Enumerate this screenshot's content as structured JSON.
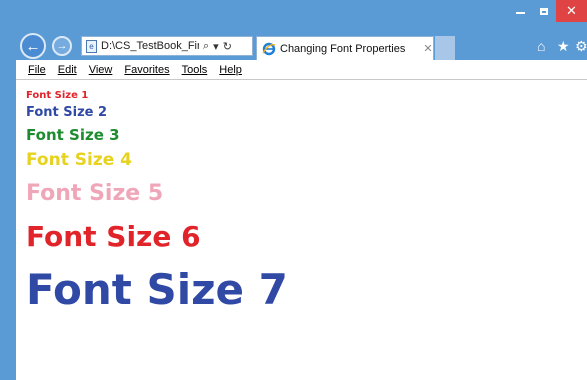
{
  "window": {
    "controls": {
      "minimize_icon": "minimize-icon",
      "maximize_icon": "maximize-icon",
      "close_glyph": "✕"
    },
    "accent_color": "#5b9bd5"
  },
  "navbar": {
    "back_glyph": "←",
    "forward_glyph": "→",
    "address": "D:\\CS_TestBook_Final\\",
    "search_glyph": "⌕",
    "dropdown_glyph": "▾",
    "refresh_glyph": "↻",
    "tab_title": "Changing Font Properties",
    "tab_close_glyph": "✕",
    "home_glyph": "⌂",
    "favorites_glyph": "★",
    "tools_glyph": "⚙"
  },
  "menubar": {
    "items": [
      "File",
      "Edit",
      "View",
      "Favorites",
      "Tools",
      "Help"
    ]
  },
  "content": {
    "lines": [
      {
        "text": "Font Size 1",
        "color": "#e0242a"
      },
      {
        "text": "Font Size 2",
        "color": "#2f49a5"
      },
      {
        "text": "Font Size 3",
        "color": "#1e8c2e"
      },
      {
        "text": "Font Size 4",
        "color": "#e6d21f"
      },
      {
        "text": "Font Size 5",
        "color": "#f0a6b9"
      },
      {
        "text": "Font Size 6",
        "color": "#e0242a"
      },
      {
        "text": "Font Size 7",
        "color": "#2f49a5"
      }
    ]
  }
}
